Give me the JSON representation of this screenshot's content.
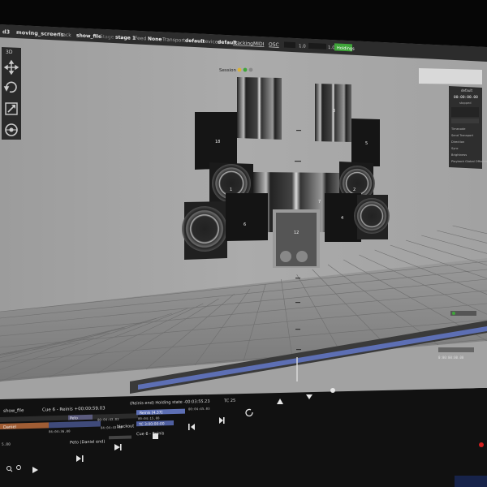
{
  "app": {
    "name": "d3",
    "project": "moving_screens",
    "track_label": "Track",
    "track_value": "show_file",
    "stage_label": "Stage",
    "stage_value": "stage 1",
    "feed_label": "Feed",
    "feed_value": "None",
    "transport_label": "Transport",
    "transport_value": "default",
    "devices_label": "Devices",
    "devices_value": "default",
    "tracking_label": "Tracking",
    "midi_label": "MIDI",
    "osc_label": "OSC",
    "zoom_value": "1.0",
    "fps_value": "1.0",
    "status_button": "Holdings"
  },
  "tools": {
    "mode_label": "3D",
    "icons": [
      "move-arrows-icon",
      "rotate-icon",
      "scale-icon",
      "orbit-icon"
    ]
  },
  "viewport": {
    "session_label": "Session",
    "screen_labels": [
      "18",
      "3",
      "5",
      "1",
      "2",
      "6",
      "4",
      "7",
      "12"
    ],
    "floor_color": "#8e8e8e",
    "wall_color": "#a4a4a4"
  },
  "panel": {
    "title": "default",
    "timecode": "00:00:00.00",
    "state": "stopped",
    "rows": [
      "Timecode",
      "Send Transport",
      "Direction",
      "Sync",
      "Brightness",
      "Playback Global Offscreen"
    ]
  },
  "timeline": {
    "track_name": "show_file",
    "cue_info": "Cue 6 - Reinis +00:00:59.03",
    "holding_state": "(Reinis end) Holding state -00:03:55.23",
    "tc": "TC 25",
    "cue_reinis": "Reinis [4.37]",
    "time_a": "00:04:45.03",
    "time_b": "00:04:15.08",
    "time_c": "04:04:36.00",
    "time_d": "00:04:43.03",
    "time_e": "04:04:43.00",
    "tc_value": "TC 3:00:00:00",
    "label_daniel": "Daniel",
    "label_peto": "Peto",
    "label_peto_end": "Peto (Daniel end)",
    "label_blackout": "blackout",
    "label_cue6": "Cue 6 - Reinis",
    "num_a": "5.00",
    "clock_right": "0:00:00:00.00"
  },
  "colors": {
    "accent_green": "#3fa53a",
    "timeline_blue": "#5d6fb4",
    "cue_orange": "#a05d34",
    "screen_dark": "#151515"
  }
}
